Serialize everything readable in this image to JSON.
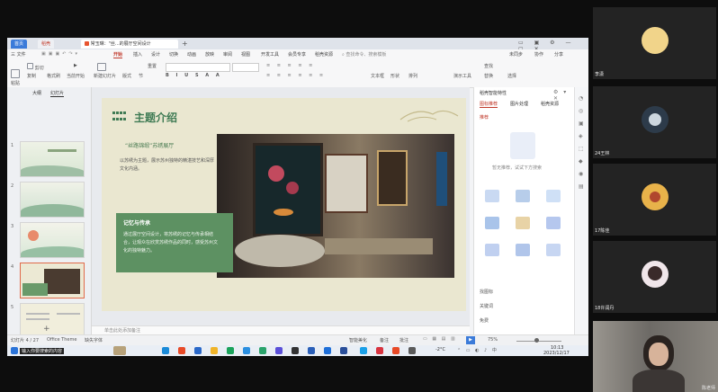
{
  "titlebar": {
    "home_tab": "首页",
    "wps_tab": "稻壳",
    "doc_tab": "常玉琳：\"丝...的展厅空间设计"
  },
  "menubar": {
    "file": "三 文件",
    "items": [
      "开始",
      "插入",
      "设计",
      "切换",
      "动画",
      "放映",
      "审阅",
      "视图",
      "开发工具",
      "会员专享",
      "稻壳资源"
    ],
    "search": "查找命令、搜索模板",
    "right_items": [
      "未同步",
      "协作",
      "分享"
    ]
  },
  "ribbon": {
    "labels": [
      "剪切",
      "粘贴",
      "复制",
      "格式刷",
      "当前开始",
      "新建幻灯片",
      "版式",
      "节",
      "重置",
      "文本框",
      "形状",
      "排列",
      "演示工具",
      "查找",
      "替换",
      "选择"
    ]
  },
  "panel_tabs": [
    "大纲",
    "幻灯片"
  ],
  "thumbnails": [
    {
      "num": "1"
    },
    {
      "num": "2"
    },
    {
      "num": "3"
    },
    {
      "num": "4"
    },
    {
      "num": "5"
    },
    {
      "num": "6"
    }
  ],
  "slide": {
    "title": "主题介绍",
    "subtitle": "“丝路锦缎”苏绣展厅",
    "body": "以苏绣为主题，展示苏州独特的精湛技艺和深厚文化内涵。",
    "box_title": "记忆与传承",
    "box_body": "通过展厅空间设计，将苏绣的记忆与传承相结合，让观众在欣赏苏绣作品的同时，感受苏州文化的独特魅力。"
  },
  "notes_placeholder": "单击此处添加备注",
  "right_panel": {
    "title": "稻壳智能特性",
    "tabs": [
      "图标推荐",
      "图片处理",
      "稻壳资源"
    ],
    "section": "推荐",
    "empty_text": "暂无推荐，试试下方搜索",
    "bottom_items": [
      "找图标",
      "关键词",
      "免费"
    ]
  },
  "status": {
    "slide_num": "幻灯片 4 / 27",
    "theme": "Office Theme",
    "font_missing": "缺失字体",
    "smart_beautify": "智能美化",
    "notes": "备注",
    "comment": "批注",
    "zoom": "75%"
  },
  "taskbar": {
    "search": "输入你要搜索的内容",
    "weather": "-2°C",
    "time": "10:13",
    "date": "2023/12/17"
  },
  "participants": [
    {
      "name": "李潇"
    },
    {
      "name": "24王林"
    },
    {
      "name": "17陈佳"
    },
    {
      "name": "18许润丹"
    },
    {
      "name": "陈老师"
    }
  ],
  "colors": {
    "accent_green": "#5a8f5c",
    "brand_orange": "#e8542f",
    "slide_bg": "#eae7d0"
  }
}
